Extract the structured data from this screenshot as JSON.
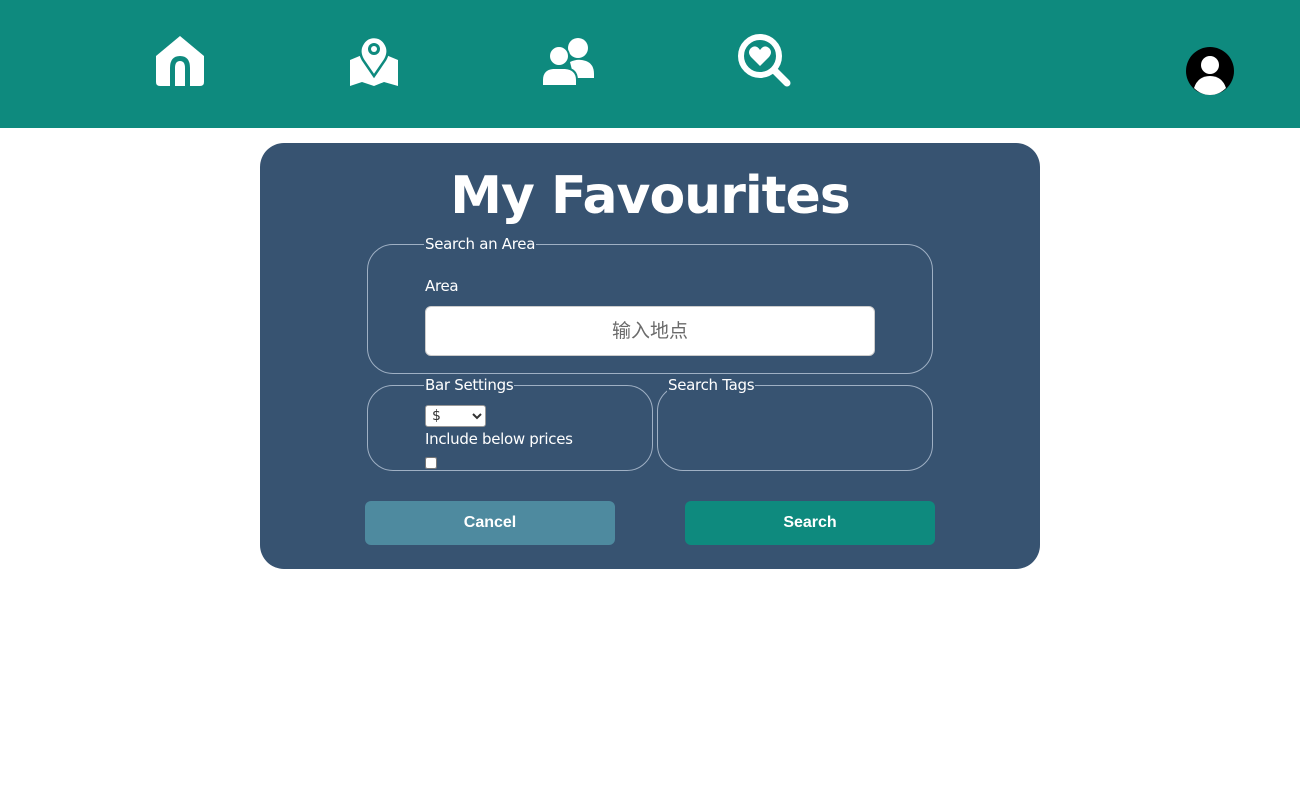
{
  "nav": {
    "items": [
      {
        "icon": "home-icon",
        "label": "Home"
      },
      {
        "icon": "map-pin-icon",
        "label": "Map"
      },
      {
        "icon": "users-icon",
        "label": "Friends"
      },
      {
        "icon": "heart-search-icon",
        "label": "Favourites"
      }
    ],
    "avatar_icon": "user-avatar-icon"
  },
  "page": {
    "title": "My Favourites"
  },
  "area_section": {
    "legend": "Search an Area",
    "label": "Area",
    "input_value": "",
    "input_placeholder": "输入地点"
  },
  "bar_settings": {
    "legend": "Bar Settings",
    "price_selected": "$",
    "price_options": [
      "$",
      "$$",
      "$$$",
      "$$$$"
    ],
    "include_below_label": "Include below prices",
    "include_below_checked": false
  },
  "search_tags": {
    "legend": "Search Tags"
  },
  "buttons": {
    "cancel_label": "Cancel",
    "search_label": "Search"
  },
  "colors": {
    "nav_bg": "#0e8a7e",
    "card_bg": "#375371",
    "cancel_bg": "#4e8a9f",
    "search_bg": "#0e8a7e"
  }
}
